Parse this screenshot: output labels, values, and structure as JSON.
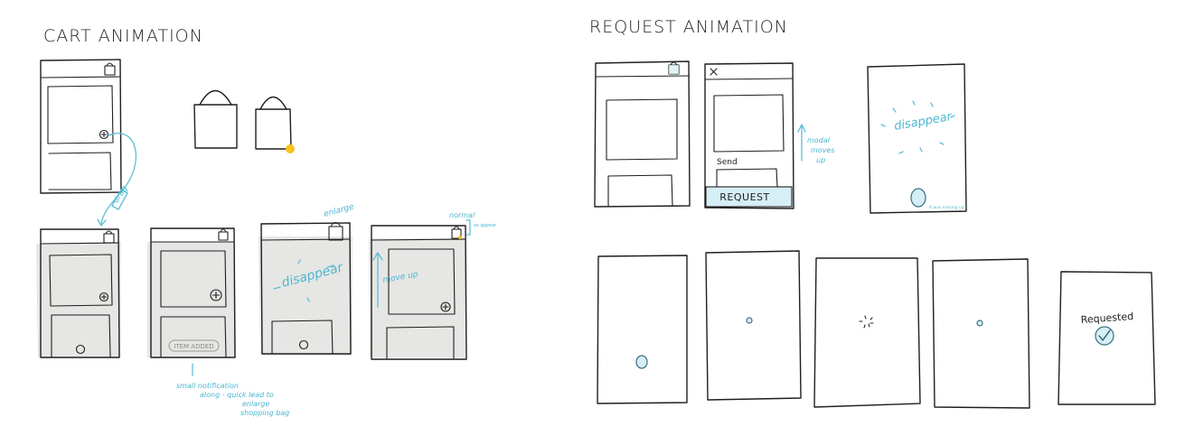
{
  "sections": {
    "cart_title": "CART ANIMATION",
    "request_title": "REQUEST ANIMATION"
  },
  "cart": {
    "drag_label": "drag",
    "enlarge_label": "enlarge",
    "normal_label": "normal",
    "normal_sub": "as appear",
    "disappear_label": "disappear",
    "move_up_label": "move up",
    "item_added_label": "ITEM ADDED",
    "note_line1": "small notification",
    "note_line2": "along - quick lead to",
    "note_line3": "enlarge",
    "note_line4": "shopping bag"
  },
  "request": {
    "send_label": "Send",
    "request_button": "REQUEST",
    "modal_line1": "modal",
    "modal_line2": "moves",
    "modal_line3": "up",
    "disappear_label": "disappear",
    "small_note": "It was moving up",
    "requested_label": "Requested"
  },
  "colors": {
    "accent": "#5bbfd6",
    "dot": "#f5c31c",
    "shade": "#e6e6e4",
    "ink": "#1f1f1f"
  }
}
